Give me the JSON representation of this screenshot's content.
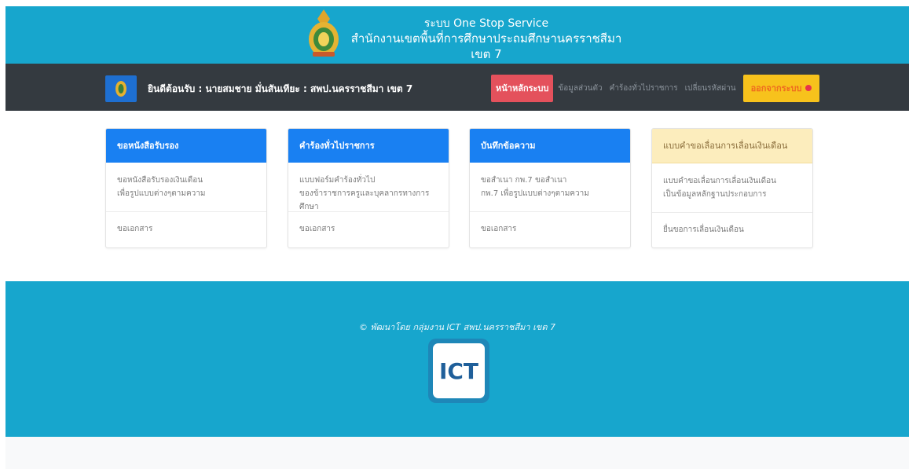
{
  "header": {
    "line1": "ระบบ One Stop Service",
    "line2": "สำนักงานเขตพื้นที่การศึกษาประถมศึกษานครราชสีมา เขต 7"
  },
  "navbar": {
    "welcome": "ยินดีต้อนรับ : นายสมชาย มั่นสันเทียะ : สพป.นครราชสีมา เขต 7",
    "home": "หน้าหลักระบบ",
    "links": [
      "ข้อมูลส่วนตัว",
      "คำร้องทั่วไปราชการ",
      "เปลี่ยนรหัสผ่าน"
    ],
    "logout": "ออกจากระบบ"
  },
  "cards": [
    {
      "title": "ขอหนังสือรับรอง",
      "body": [
        "ขอหนังสือรับรองเงินเดือน",
        "เพื่อรูปแบบต่างๆตามความ"
      ],
      "footer": "ขอเอกสาร",
      "style": "primary"
    },
    {
      "title": "คำร้องทั่วไปราชการ",
      "body": [
        "แบบฟอร์มคำร้องทั่วไป",
        "ของข้าราชการครูและบุคลากรทางการศึกษา"
      ],
      "footer": "ขอเอกสาร",
      "style": "primary"
    },
    {
      "title": "บันทึกข้อความ",
      "body": [
        "ขอสำเนา กพ.7 ขอสำเนา",
        "กพ.7 เพื่อรูปแบบต่างๆตามความ"
      ],
      "footer": "ขอเอกสาร",
      "style": "primary"
    },
    {
      "title": "แบบคำขอเลื่อนการเลื่อนเงินเดือน",
      "body": [
        "แบบคำขอเลื่อนการเลื่อนเงินเดือน",
        "เป็นข้อมูลหลักฐานประกอบการ"
      ],
      "footer": "ยื่นขอการเลื่อนเงินเดือน",
      "style": "warning"
    }
  ],
  "footer": {
    "credit": "© พัฒนาโดย กลุ่มงาน ICT สพป.นครราชสีมา เขต 7",
    "logo_text": "ICT"
  },
  "colors": {
    "header_bg": "#17a6cd",
    "navbar_bg": "#343a40",
    "primary": "#1980f2",
    "danger": "#e4515c",
    "warning": "#f7c21c"
  }
}
